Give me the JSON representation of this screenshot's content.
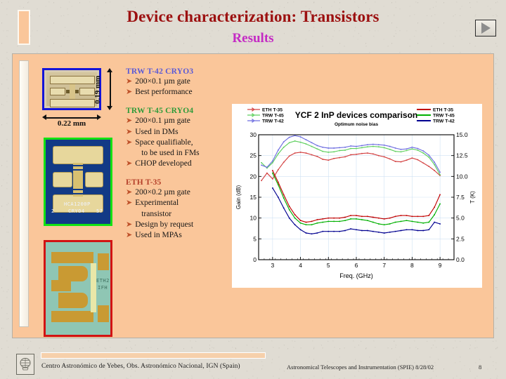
{
  "header": {
    "title": "Device characterization: Transistors",
    "subtitle": "Results",
    "next_button": "next-slide",
    "title_color": "#9c1010",
    "subtitle_color": "#c42ac4"
  },
  "chips": [
    {
      "name": "TRW T-42 CRYO3 die photo",
      "border_color": "#1414d8",
      "dim_width": "0.22 mm",
      "dim_height": "0.19 mm"
    },
    {
      "name": "TRW T-45 CRYO4 die photo",
      "border_color": "#13e213",
      "labels": [
        "HCA1200P",
        "CRYO4",
        "2",
        "57"
      ]
    },
    {
      "name": "ETH T-35 die photo",
      "border_color": "#d11313",
      "labels": [
        "ETH2",
        "IFH"
      ]
    }
  ],
  "groups": [
    {
      "heading": "TRW T-42 CRYO3",
      "heading_color": "#5b5bd6",
      "bullets": [
        [
          "200×0.1 µm gate"
        ],
        [
          "Best performance"
        ]
      ]
    },
    {
      "heading": "TRW T-45 CRYO4",
      "heading_color": "#2f9b3a",
      "bullets": [
        [
          "200×0.1 µm gate"
        ],
        [
          "Used in DMs"
        ],
        [
          "Space qualifiable,",
          "to be used in FMs"
        ],
        [
          "CHOP developed"
        ]
      ]
    },
    {
      "heading": "ETH T-35",
      "heading_color": "#b5402a",
      "bullets": [
        [
          "200×0.2 µm gate"
        ],
        [
          "Experimental",
          "transistor"
        ],
        [
          "Design by request"
        ],
        [
          "Used in MPAs"
        ]
      ]
    }
  ],
  "bullet_marker": "➤",
  "chart_data": {
    "type": "line",
    "title": "YCF 2 InP devices comparison",
    "subtitle": "Optimum noise bias",
    "xlabel": "Freq. (GHz)",
    "ylabel_left": "Gain (dB)",
    "ylabel_right": "T (K)",
    "xlim": [
      2.5,
      9.5
    ],
    "xticks": [
      3,
      4,
      5,
      6,
      7,
      8,
      9
    ],
    "ylim_left": [
      0,
      30
    ],
    "yticks_left": [
      0,
      5,
      10,
      15,
      20,
      25,
      30
    ],
    "ylim_right": [
      0.0,
      15.0
    ],
    "yticks_right": [
      "0.0",
      "2.5",
      "5.0",
      "7.5",
      "10.0",
      "12.5",
      "15.0"
    ],
    "grid": true,
    "legend_position": "top-left and top-right",
    "legend_left": [
      {
        "name": "ETH T-35",
        "color": "#d34040"
      },
      {
        "name": "TRW T-45",
        "color": "#5fcf5f"
      },
      {
        "name": "TRW T-42",
        "color": "#6d6de0"
      }
    ],
    "legend_right": [
      {
        "name": "ETH T-35",
        "color": "#c00000"
      },
      {
        "name": "TRW T-45",
        "color": "#00b000"
      },
      {
        "name": "TRW T-42",
        "color": "#000090"
      }
    ],
    "x": [
      2.6,
      2.8,
      3.0,
      3.2,
      3.4,
      3.6,
      3.8,
      4.0,
      4.2,
      4.4,
      4.6,
      4.8,
      5.0,
      5.2,
      5.4,
      5.6,
      5.8,
      6.0,
      6.2,
      6.4,
      6.6,
      6.8,
      7.0,
      7.2,
      7.4,
      7.6,
      7.8,
      8.0,
      8.2,
      8.4,
      8.6,
      8.8,
      9.0
    ],
    "series": [
      {
        "name": "ETH T-35 gain",
        "axis": "left",
        "color": "#d34040",
        "values": [
          19.0,
          20.8,
          19.4,
          21.6,
          23.4,
          24.9,
          25.6,
          25.8,
          25.6,
          25.2,
          24.8,
          24.1,
          23.9,
          24.3,
          24.5,
          24.7,
          25.2,
          25.3,
          25.5,
          25.6,
          25.4,
          25.0,
          24.7,
          24.2,
          23.6,
          23.5,
          23.9,
          24.4,
          24.0,
          23.2,
          22.4,
          21.4,
          20.2
        ]
      },
      {
        "name": "TRW T-45 gain",
        "axis": "left",
        "color": "#5fcf5f",
        "values": [
          23.3,
          22.0,
          23.3,
          25.4,
          27.0,
          28.1,
          28.5,
          28.2,
          27.8,
          27.2,
          26.6,
          26.0,
          25.8,
          25.9,
          26.2,
          26.3,
          26.7,
          26.7,
          26.9,
          27.1,
          27.2,
          27.1,
          26.9,
          26.5,
          26.0,
          25.9,
          26.2,
          26.6,
          26.3,
          25.6,
          24.6,
          22.8,
          20.4
        ]
      },
      {
        "name": "TRW T-42 gain",
        "axis": "left",
        "color": "#6d6de0",
        "values": [
          22.7,
          22.2,
          23.7,
          26.3,
          28.3,
          29.4,
          29.8,
          29.5,
          28.8,
          28.1,
          27.4,
          27.0,
          26.8,
          26.8,
          26.9,
          27.0,
          27.3,
          27.2,
          27.4,
          27.6,
          27.7,
          27.6,
          27.5,
          27.2,
          26.8,
          26.5,
          26.6,
          27.0,
          26.7,
          26.1,
          25.1,
          23.4,
          21.0
        ]
      },
      {
        "name": "ETH T-35 noise T",
        "axis": "right",
        "color": "#c00000",
        "values": [
          null,
          null,
          10.7,
          9.3,
          7.8,
          6.4,
          5.4,
          4.7,
          4.5,
          4.6,
          4.8,
          4.9,
          5.0,
          5.0,
          5.0,
          5.1,
          5.3,
          5.3,
          5.2,
          5.2,
          5.1,
          5.0,
          4.9,
          5.0,
          5.2,
          5.3,
          5.3,
          5.2,
          5.2,
          5.2,
          5.3,
          6.3,
          7.8
        ]
      },
      {
        "name": "TRW T-45 noise T",
        "axis": "right",
        "color": "#00b000",
        "values": [
          null,
          null,
          10.4,
          9.0,
          7.4,
          6.0,
          5.0,
          4.4,
          4.2,
          4.2,
          4.4,
          4.5,
          4.6,
          4.6,
          4.6,
          4.7,
          4.9,
          4.9,
          4.8,
          4.7,
          4.5,
          4.3,
          4.2,
          4.3,
          4.5,
          4.6,
          4.7,
          4.6,
          4.5,
          4.4,
          4.5,
          5.4,
          6.7
        ]
      },
      {
        "name": "TRW T-42 noise T",
        "axis": "right",
        "color": "#000090",
        "values": [
          null,
          null,
          8.6,
          7.5,
          6.2,
          5.0,
          4.2,
          3.6,
          3.2,
          3.1,
          3.2,
          3.4,
          3.4,
          3.4,
          3.4,
          3.5,
          3.7,
          3.6,
          3.5,
          3.5,
          3.4,
          3.3,
          3.2,
          3.3,
          3.4,
          3.5,
          3.6,
          3.6,
          3.5,
          3.5,
          3.6,
          4.5,
          4.3
        ]
      }
    ]
  },
  "footer": {
    "institution": "Centro Astronómico de Yebes, Obs. Astronómico Nacional, IGN (Spain)",
    "conference": "Astronomical Telescopes and Instrumentation (SPIE)  8/28/02",
    "page_number": "8",
    "logo": "observatory-logo"
  }
}
